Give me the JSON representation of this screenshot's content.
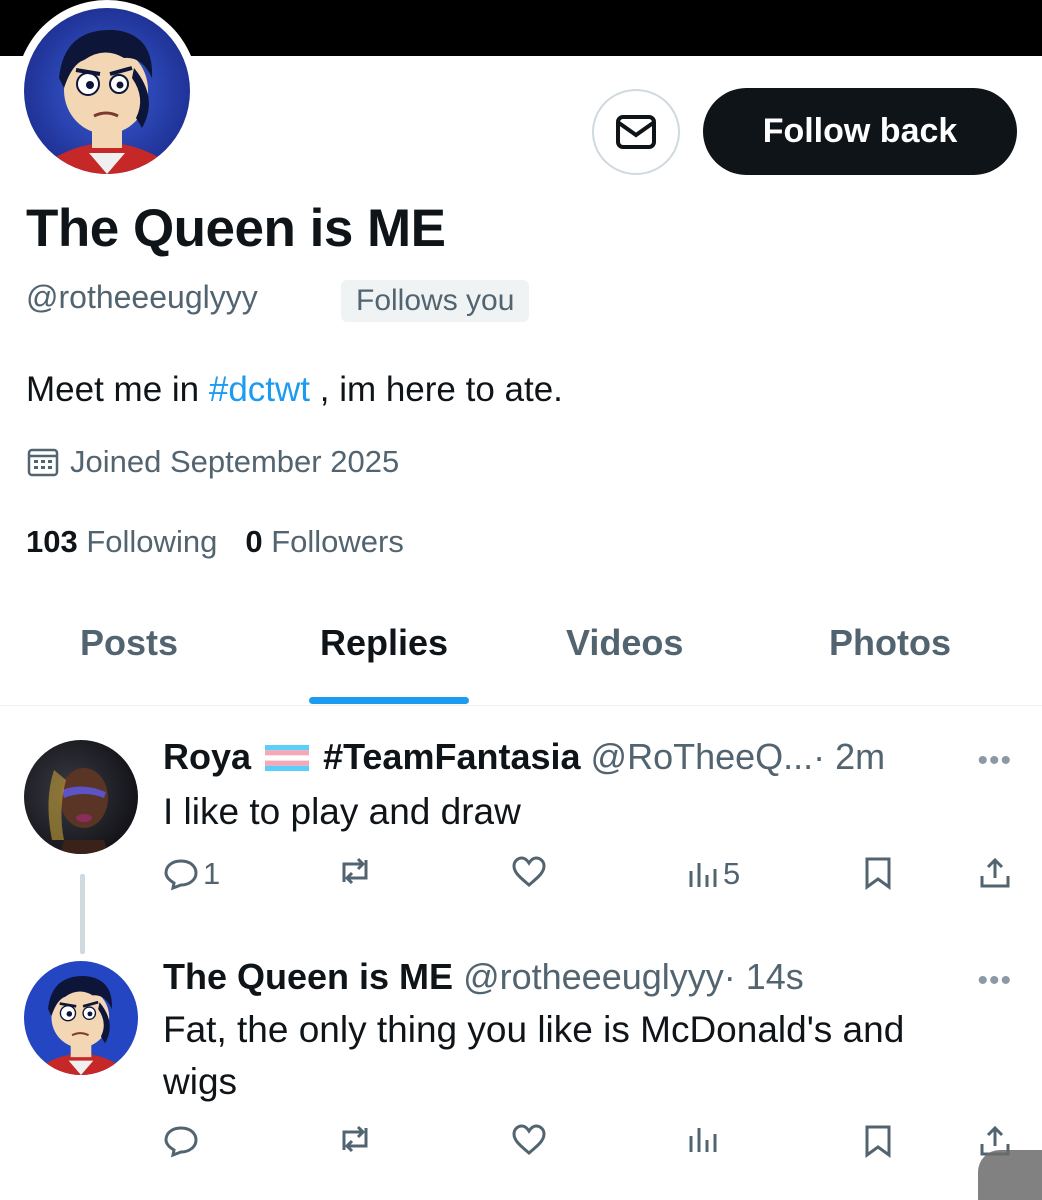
{
  "profile": {
    "display_name": "The Queen is ME",
    "handle": "@rotheeeuglyyy",
    "follows_you_badge": "Follows you",
    "bio_before": "Meet me in ",
    "bio_hashtag": "#dctwt",
    "bio_after": " , im here to ate.",
    "joined": "Joined September 2025",
    "following_count": "103",
    "following_label": "Following",
    "followers_count": "0",
    "followers_label": "Followers"
  },
  "buttons": {
    "message_icon": "envelope-icon",
    "follow_back": "Follow back"
  },
  "tabs": [
    {
      "label": "Posts"
    },
    {
      "label": "Replies",
      "active": true
    },
    {
      "label": "Videos"
    },
    {
      "label": "Photos"
    }
  ],
  "tweets": [
    {
      "name": "Roya",
      "flag": "transgender-flag-icon",
      "name_suffix": "#TeamFantasia",
      "handle": "@RoTheeQ...",
      "time": "· 2m",
      "text": "I like to play and draw",
      "replies": "1",
      "views": "5"
    },
    {
      "name": "The Queen is ME",
      "handle": "@rotheeeuglyyy",
      "time": "· 14s",
      "text": "Fat, the only thing you like is McDonald's and wigs"
    }
  ],
  "colors": {
    "accent": "#1d9bf0",
    "text": "#0f1419",
    "secondary": "#536471",
    "button_dark": "#0f1419"
  }
}
